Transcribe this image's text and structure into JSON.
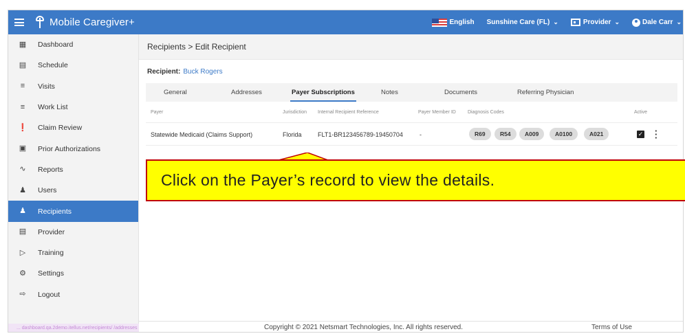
{
  "app": {
    "title": "Mobile Caregiver+"
  },
  "topbar": {
    "language": "English",
    "agency": "Sunshine Care (FL)",
    "role": "Provider",
    "user": "Dale Carr"
  },
  "sidebar": {
    "items": [
      {
        "label": "Dashboard",
        "icon": "dashboard-icon"
      },
      {
        "label": "Schedule",
        "icon": "calendar-icon"
      },
      {
        "label": "Visits",
        "icon": "filter-icon"
      },
      {
        "label": "Work List",
        "icon": "list-icon"
      },
      {
        "label": "Claim Review",
        "icon": "alert-circle-icon"
      },
      {
        "label": "Prior Authorizations",
        "icon": "calendar-check-icon"
      },
      {
        "label": "Reports",
        "icon": "trend-icon"
      },
      {
        "label": "Users",
        "icon": "users-icon"
      },
      {
        "label": "Recipients",
        "icon": "recipients-icon",
        "active": true
      },
      {
        "label": "Provider",
        "icon": "clipboard-icon"
      },
      {
        "label": "Training",
        "icon": "play-box-icon"
      },
      {
        "label": "Settings",
        "icon": "gear-icon"
      },
      {
        "label": "Logout",
        "icon": "logout-icon"
      }
    ],
    "status_url": "... dashboard.qa.2demo.itellus.net/recipients/ /addresses"
  },
  "main": {
    "breadcrumb": "Recipients > Edit Recipient",
    "recipient_label": "Recipient:",
    "recipient_name": "Buck Rogers",
    "tabs": [
      "General",
      "Addresses",
      "Payer Subscriptions",
      "Notes",
      "Documents",
      "Referring Physician"
    ],
    "active_tab": "Payer Subscriptions",
    "columns": {
      "payer": "Payer",
      "jurisdiction": "Jurisdiction",
      "internal_ref": "Internal Recipient Reference",
      "member_id": "Payer Member ID",
      "diagnosis": "Diagnosis Codes",
      "active": "Active"
    },
    "row": {
      "payer": "Statewide Medicaid (Claims Support)",
      "jurisdiction": "Florida",
      "internal_ref": "FLT1-BR123456789-19450704",
      "member_id": "-",
      "codes": [
        "R69",
        "R54",
        "A009",
        "A0100",
        "A021"
      ],
      "active": true
    }
  },
  "footer": {
    "copyright": "Copyright © 2021 Netsmart Technologies, Inc. All rights reserved.",
    "terms": "Terms of Use"
  },
  "callout": {
    "text": "Click on the Payer’s record to view the details."
  },
  "colors": {
    "brand": "#3c7ac7",
    "callout_fill": "#ffff00",
    "callout_border": "#c00000"
  }
}
